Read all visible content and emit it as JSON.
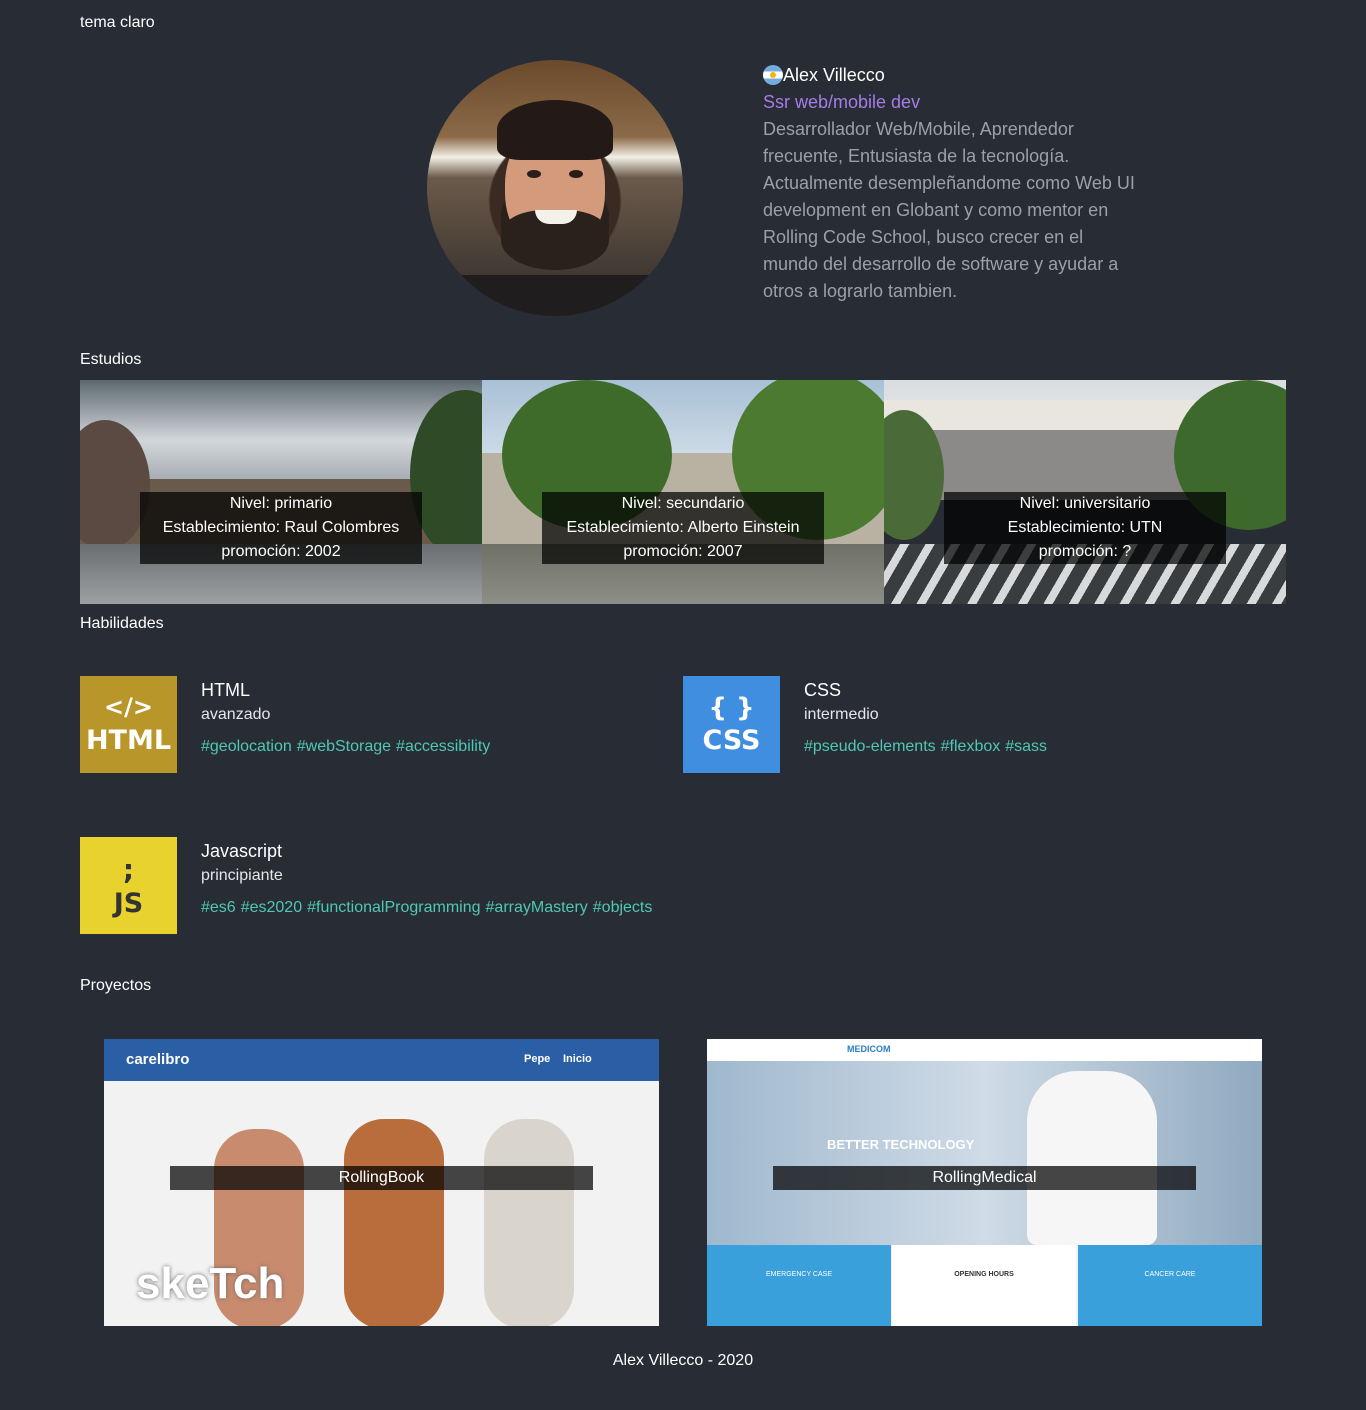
{
  "theme_toggle": "tema claro",
  "profile": {
    "name": "Alex Villecco",
    "role": "Ssr web/mobile dev",
    "bio": "Desarrollador Web/Mobile, Aprendedor frecuente, Entusiasta de la tecnología. Actualmente desempleñandome como Web UI development en Globant y como mentor en Rolling Code School, busco crecer en el mundo del desarrollo de software y ayudar a otros a lograrlo tambien."
  },
  "sections": {
    "studies": "Estudios",
    "skills": "Habilidades",
    "projects": "Proyectos"
  },
  "studies": [
    {
      "level": "Nivel: primario",
      "school": "Establecimiento: Raul Colombres",
      "year": "promoción: 2002"
    },
    {
      "level": "Nivel: secundario",
      "school": "Establecimiento: Alberto Einstein",
      "year": "promoción: 2007"
    },
    {
      "level": "Nivel: universitario",
      "school": "Establecimiento: UTN",
      "year": "promoción: ?"
    }
  ],
  "skills": [
    {
      "name": "HTML",
      "level": "avanzado",
      "logo_top": "</>",
      "logo_bottom": "HTML",
      "color": "#b8962a",
      "tags": [
        "#geolocation",
        "#webStorage",
        "#accessibility"
      ]
    },
    {
      "name": "CSS",
      "level": "intermedio",
      "logo_top": "{ }",
      "logo_bottom": "CSS",
      "color": "#3f8ee0",
      "tags": [
        "#pseudo-elements",
        "#flexbox",
        "#sass"
      ]
    },
    {
      "name": "Javascript",
      "level": "principiante",
      "logo_top": ";",
      "logo_bottom": "JS",
      "color": "#e8d32e",
      "tags": [
        "#es6",
        "#es2020",
        "#functionalProgramming",
        "#arrayMastery",
        "#objects"
      ]
    }
  ],
  "projects": [
    {
      "name": "RollingBook",
      "brand": "carelibro",
      "nav": [
        "Pepe",
        "Inicio"
      ],
      "overlay_text": "skeTch"
    },
    {
      "name": "RollingMedical",
      "brand": "MEDICOM",
      "hero": "BETTER TECHNOLOGY",
      "cards": [
        "EMERGENCY CASE",
        "OPENING HOURS",
        "CANCER CARE"
      ]
    }
  ],
  "footer": "Alex Villecco - 2020",
  "colors": {
    "background": "#282c34",
    "accent_purple": "#a67ce8",
    "tag_green": "#4fc8b5"
  }
}
